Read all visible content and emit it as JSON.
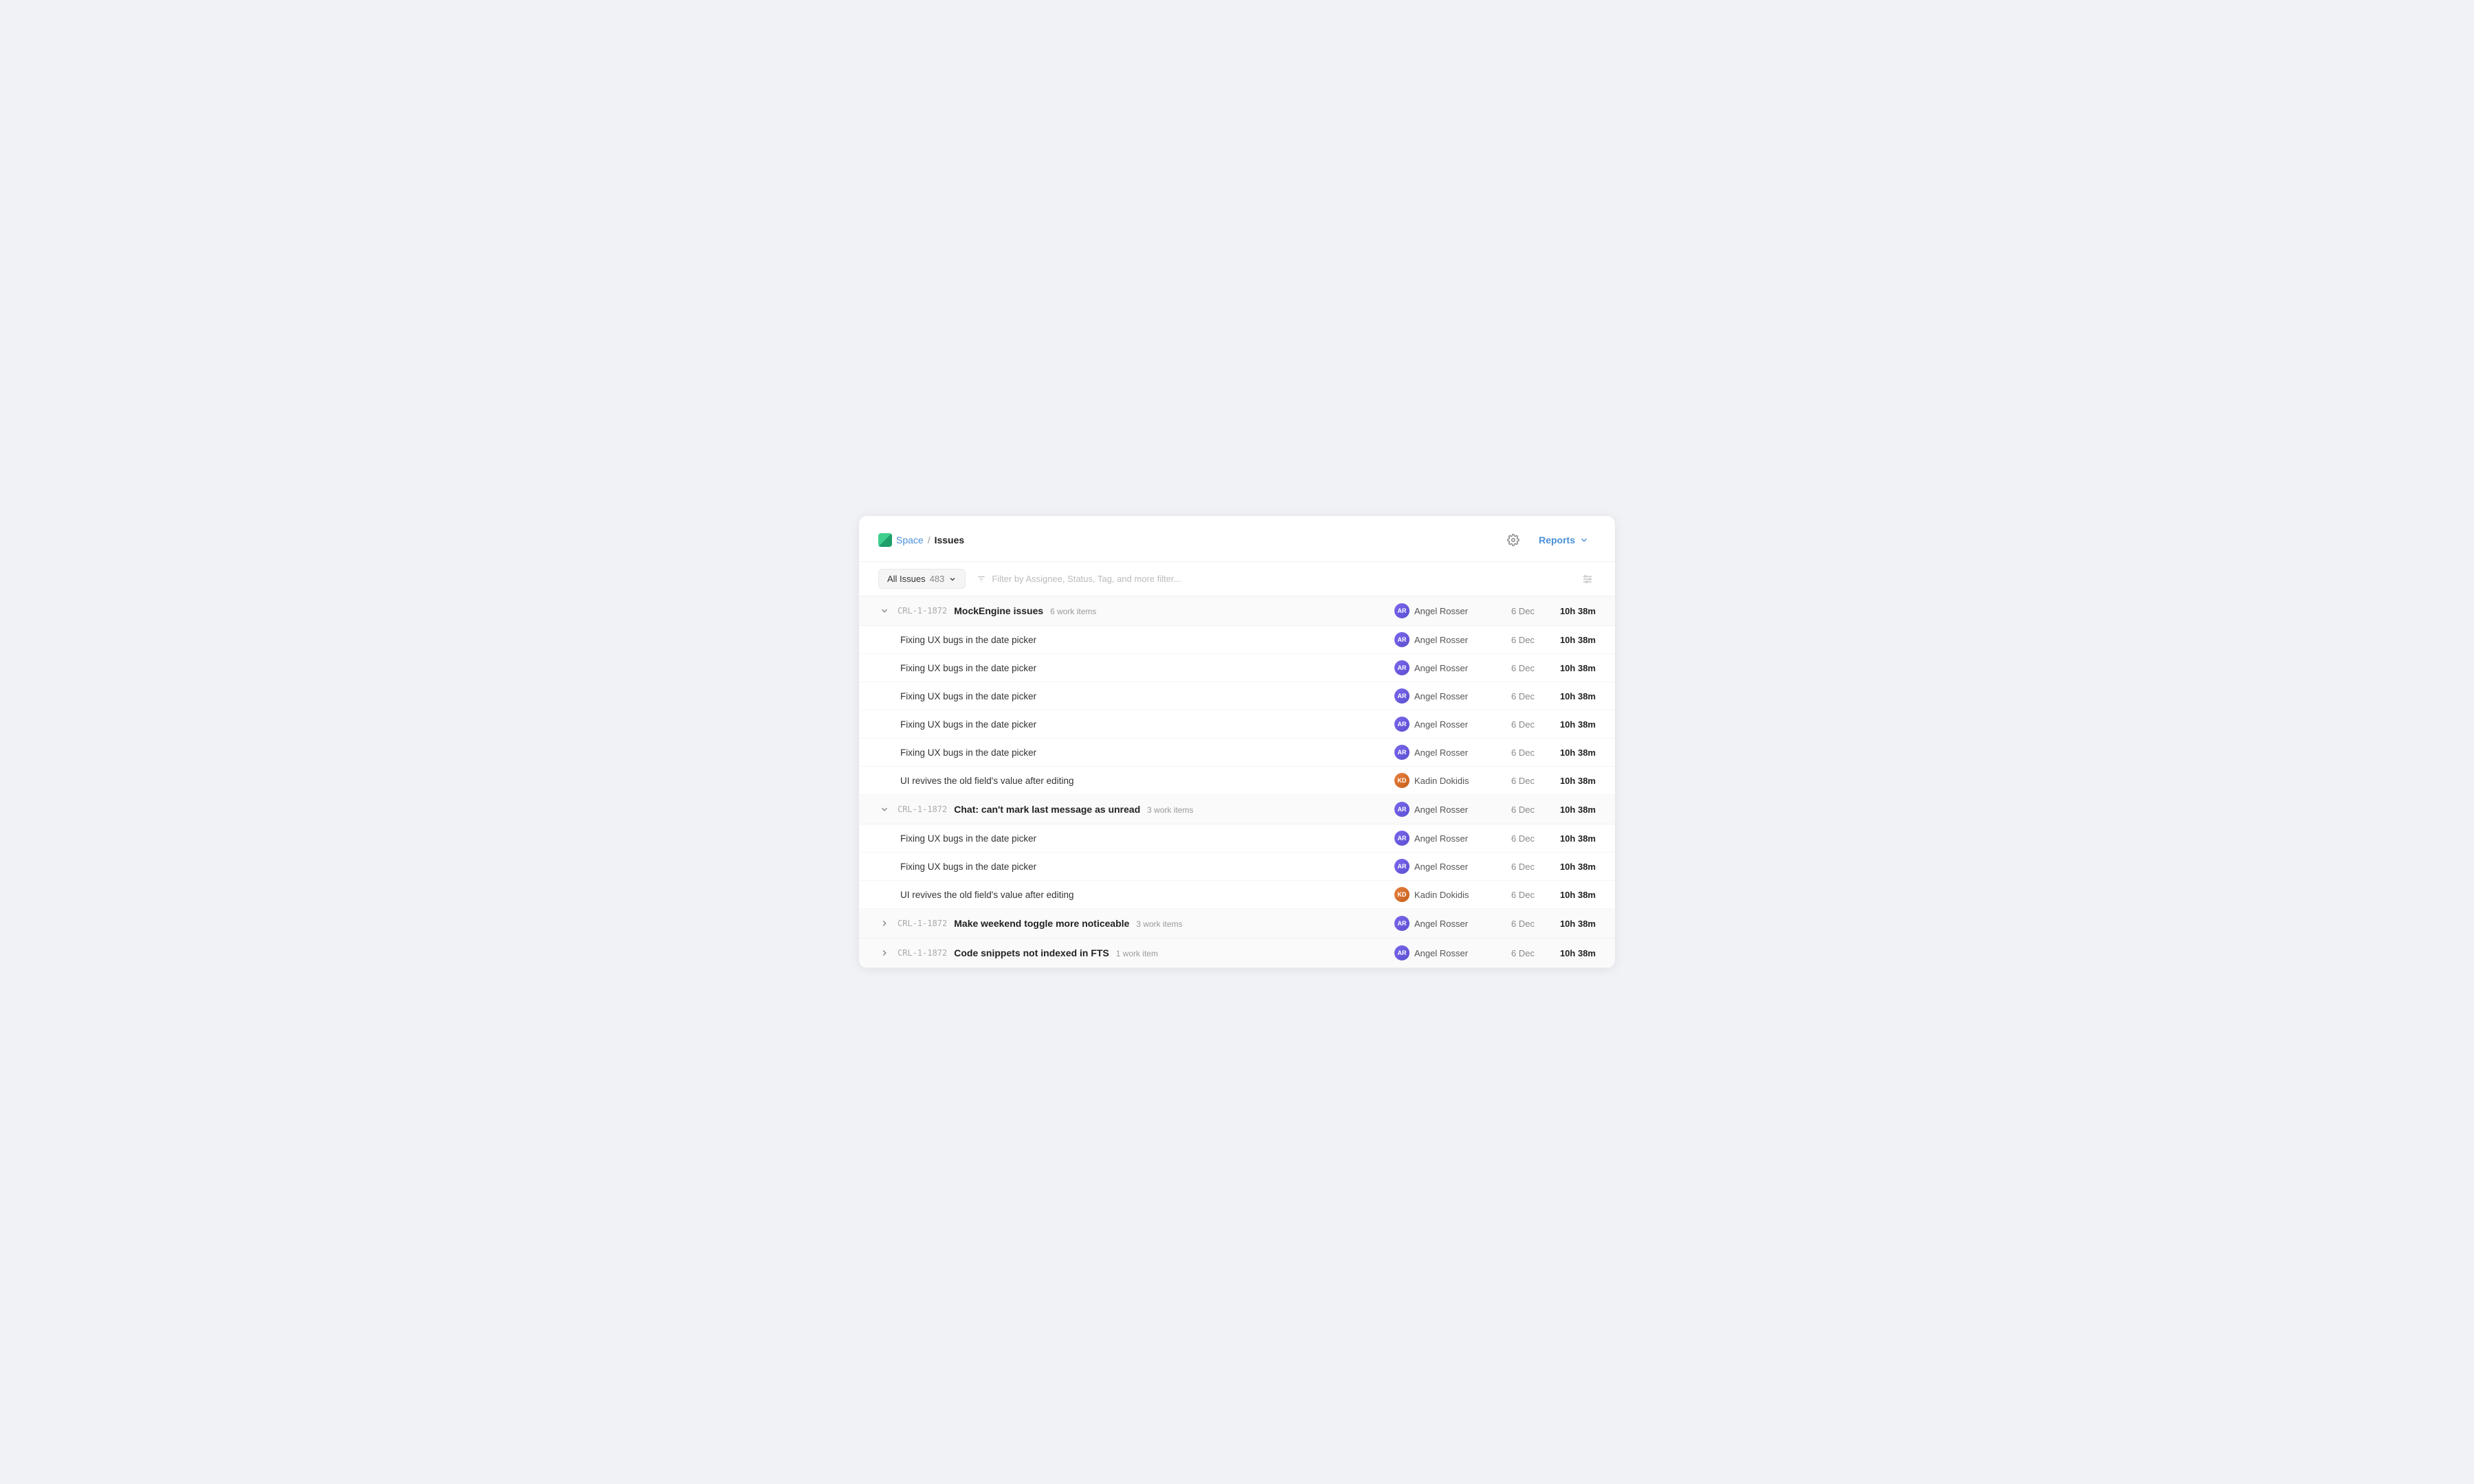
{
  "header": {
    "space_label": "Space",
    "breadcrumb_sep": "/",
    "page_title": "Issues",
    "gear_label": "Settings",
    "reports_label": "Reports",
    "reports_dropdown": "▾"
  },
  "toolbar": {
    "filter_label": "All Issues",
    "filter_count": "483",
    "filter_placeholder": "Filter by Assignee, Status, Tag, and more filter...",
    "dropdown_arrow": "▾"
  },
  "groups": [
    {
      "id": "group-1",
      "expanded": true,
      "code": "CRL-1-1872",
      "title": "MockEngine issues",
      "work_items_label": "6 work items",
      "assignee_name": "Angel Rosser",
      "assignee_type": "ar",
      "date": "6 Dec",
      "time": "10h 38m",
      "children": [
        {
          "title": "Fixing UX bugs in the date picker",
          "assignee_name": "Angel Rosser",
          "assignee_type": "ar",
          "date": "6 Dec",
          "time": "10h 38m"
        },
        {
          "title": "Fixing UX bugs in the date picker",
          "assignee_name": "Angel Rosser",
          "assignee_type": "ar",
          "date": "6 Dec",
          "time": "10h 38m"
        },
        {
          "title": "Fixing UX bugs in the date picker",
          "assignee_name": "Angel Rosser",
          "assignee_type": "ar",
          "date": "6 Dec",
          "time": "10h 38m"
        },
        {
          "title": "Fixing UX bugs in the date picker",
          "assignee_name": "Angel Rosser",
          "assignee_type": "ar",
          "date": "6 Dec",
          "time": "10h 38m"
        },
        {
          "title": "Fixing UX bugs in the date picker",
          "assignee_name": "Angel Rosser",
          "assignee_type": "ar",
          "date": "6 Dec",
          "time": "10h 38m"
        },
        {
          "title": "UI revives the old field's value after editing",
          "assignee_name": "Kadin Dokidis",
          "assignee_type": "kd",
          "date": "6 Dec",
          "time": "10h 38m"
        }
      ]
    },
    {
      "id": "group-2",
      "expanded": true,
      "code": "CRL-1-1872",
      "title": "Chat: can't mark last message as unread",
      "work_items_label": "3 work items",
      "assignee_name": "Angel Rosser",
      "assignee_type": "ar",
      "date": "6 Dec",
      "time": "10h 38m",
      "children": [
        {
          "title": "Fixing UX bugs in the date picker",
          "assignee_name": "Angel Rosser",
          "assignee_type": "ar",
          "date": "6 Dec",
          "time": "10h 38m"
        },
        {
          "title": "Fixing UX bugs in the date picker",
          "assignee_name": "Angel Rosser",
          "assignee_type": "ar",
          "date": "6 Dec",
          "time": "10h 38m"
        },
        {
          "title": "UI revives the old field's value after editing",
          "assignee_name": "Kadin Dokidis",
          "assignee_type": "kd",
          "date": "6 Dec",
          "time": "10h 38m"
        }
      ]
    },
    {
      "id": "group-3",
      "expanded": false,
      "code": "CRL-1-1872",
      "title": "Make weekend toggle more noticeable",
      "work_items_label": "3 work items",
      "assignee_name": "Angel Rosser",
      "assignee_type": "ar",
      "date": "6 Dec",
      "time": "10h 38m",
      "children": []
    },
    {
      "id": "group-4",
      "expanded": false,
      "code": "CRL-1-1872",
      "title": "Code snippets not indexed in FTS",
      "work_items_label": "1 work item",
      "assignee_name": "Angel Rosser",
      "assignee_type": "ar",
      "date": "6 Dec",
      "time": "10h 38m",
      "children": []
    }
  ]
}
